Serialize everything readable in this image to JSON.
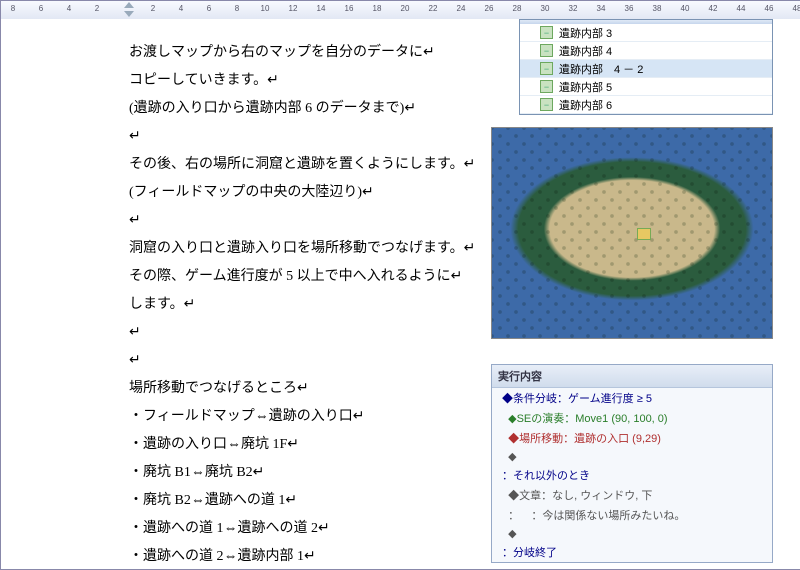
{
  "ruler_ticks": [
    8,
    6,
    4,
    2,
    "",
    2,
    4,
    6,
    8,
    10,
    12,
    14,
    16,
    18,
    20,
    22,
    24,
    26,
    28,
    30,
    32,
    34,
    36,
    38,
    40,
    42,
    44,
    46,
    48
  ],
  "body": {
    "p1": "お渡しマップから右のマップを自分のデータに↵",
    "p2": "コピーしていきます。↵",
    "p3": "(遺跡の入り口から遺跡内部 6 のデータまで)↵",
    "p4": "その後、右の場所に洞窟と遺跡を置くようにします。↵",
    "p5": "(フィールドマップの中央の大陸辺り)↵",
    "p6": "洞窟の入り口と遺跡入り口を場所移動でつなげます。↵",
    "p7": "その際、ゲーム進行度が 5 以上で中へ入れるように↵",
    "p8": "します。↵",
    "p9": "場所移動でつなげるところ↵",
    "p10": "・フィールドマップ⇔遺跡の入り口↵",
    "p11": "・遺跡の入り口⇔廃坑 1F↵",
    "p12": "・廃坑 B1⇔廃坑 B2↵",
    "p13": "・廃坑 B2⇔遺跡への道 1↵",
    "p14": "・遺跡への道 1⇔遺跡への道 2↵",
    "p15": "・遺跡への道 2⇔遺跡内部 1↵"
  },
  "maplist": {
    "items": [
      "遺跡内部 3",
      "遺跡内部 4",
      "遺跡内部　4 － 2",
      "遺跡内部 5",
      "遺跡内部 6"
    ],
    "selected_index": 2
  },
  "event": {
    "title": "実行内容",
    "l1": "◆条件分岐：ゲーム進行度 ≥ 5",
    "l2": "  ◆SEの演奏：Move1 (90, 100, 0)",
    "l3": "  ◆場所移動：遺跡の入口 (9,29)",
    "l4": "  ◆",
    "l5": "：それ以外のとき",
    "l6": "  ◆文章：なし, ウィンドウ, 下",
    "l7": "  ：    ：今は関係ない場所みたいね。",
    "l8": "  ◆",
    "l9": "：分岐終了"
  }
}
